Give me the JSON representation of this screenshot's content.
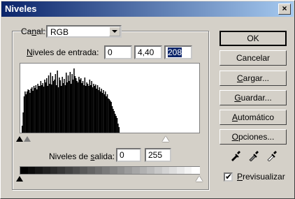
{
  "window": {
    "title": "Niveles",
    "close_glyph": "×"
  },
  "channel": {
    "label_before": "Ca",
    "label_underlined": "n",
    "label_after": "al:",
    "value": "RGB"
  },
  "input_levels": {
    "label_before": "",
    "label_underlined": "N",
    "label_after": "iveles de entrada:",
    "values": [
      "0",
      "4,40",
      "208"
    ]
  },
  "output_levels": {
    "label_before": "Niveles de ",
    "label_underlined": "s",
    "label_after": "alida:",
    "values": [
      "0",
      "255"
    ]
  },
  "buttons": {
    "ok": "OK",
    "cancel": "Cancelar",
    "load_u": "C",
    "load_rest": "argar...",
    "save_u": "G",
    "save_rest": "uardar...",
    "auto_u": "A",
    "auto_rest": "utomático",
    "options_u": "O",
    "options_rest": "pciones..."
  },
  "preview": {
    "checked": true,
    "label_u": "P",
    "label_rest": "revisualizar",
    "check_glyph": "✔"
  },
  "histogram": {
    "counts": [
      10,
      30,
      55,
      62,
      58,
      62,
      65,
      64,
      60,
      66,
      68,
      63,
      70,
      67,
      72,
      65,
      74,
      70,
      71,
      78,
      72,
      75,
      69,
      80,
      76,
      82,
      70,
      86,
      74,
      90,
      73,
      85,
      78,
      80,
      88,
      72,
      94,
      68,
      83,
      79,
      70,
      84,
      75,
      81,
      72,
      90,
      76,
      86,
      78,
      92,
      74,
      88,
      80,
      97,
      85,
      82,
      78,
      76,
      84,
      80,
      82,
      75,
      78,
      72,
      83,
      70,
      76,
      74,
      70,
      80,
      72,
      78,
      68,
      74,
      70,
      73,
      66,
      72,
      64,
      68,
      62,
      66,
      60,
      64,
      58,
      62,
      55,
      58,
      52,
      50,
      48,
      46,
      40,
      36,
      33,
      28,
      25,
      22,
      14,
      8
    ]
  },
  "icons": {
    "eyedroppers": [
      "black-eyedropper-icon",
      "gray-eyedropper-icon",
      "white-eyedropper-icon"
    ]
  }
}
